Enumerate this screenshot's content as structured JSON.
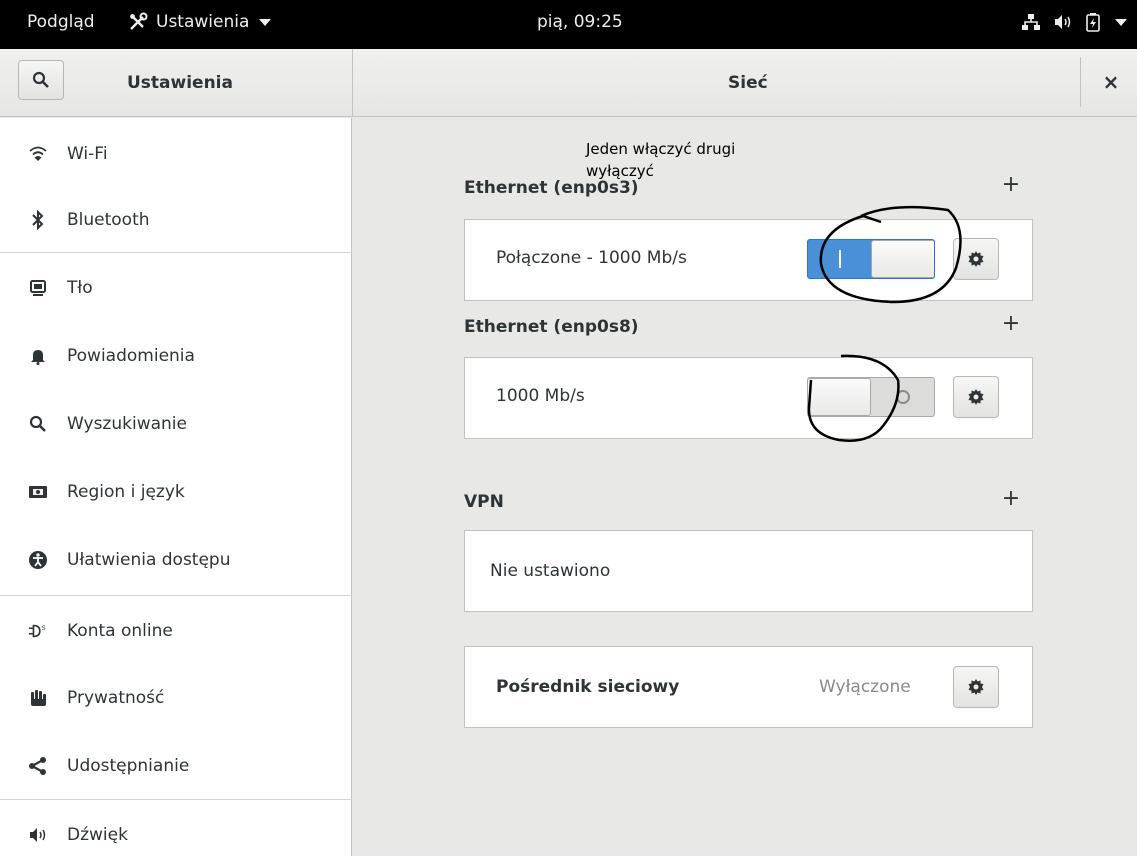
{
  "topbar": {
    "activities": "Podgląd",
    "app_menu": "Ustawienia",
    "clock": "pią, 09:25"
  },
  "header": {
    "left_title": "Ustawienia",
    "main_title": "Sieć",
    "close": "×"
  },
  "sidebar": {
    "items": [
      {
        "label": "Wi-Fi",
        "icon": "wifi-icon"
      },
      {
        "label": "Bluetooth",
        "icon": "bluetooth-icon"
      },
      {
        "label": "Tło",
        "icon": "background-icon"
      },
      {
        "label": "Powiadomienia",
        "icon": "bell-icon"
      },
      {
        "label": "Wyszukiwanie",
        "icon": "search-icon"
      },
      {
        "label": "Region i język",
        "icon": "region-icon"
      },
      {
        "label": "Ułatwienia dostępu",
        "icon": "accessibility-icon"
      },
      {
        "label": "Konta online",
        "icon": "online-accounts-icon"
      },
      {
        "label": "Prywatność",
        "icon": "privacy-hand-icon"
      },
      {
        "label": "Udostępnianie",
        "icon": "share-icon"
      },
      {
        "label": "Dźwięk",
        "icon": "speaker-icon"
      }
    ]
  },
  "network": {
    "annotation": "Jeden włączyć drugi wyłączyć",
    "ethernet1": {
      "title": "Ethernet (enp0s3)",
      "status": "Połączone - 1000 Mb/s",
      "switch_on": true
    },
    "ethernet2": {
      "title": "Ethernet (enp0s8)",
      "status": "1000 Mb/s",
      "switch_on": false
    },
    "vpn": {
      "title": "VPN",
      "status": "Nie ustawiono"
    },
    "proxy": {
      "label": "Pośrednik sieciowy",
      "value": "Wyłączone"
    },
    "add_symbol": "+"
  },
  "colors": {
    "accent": "#4a90d9",
    "topbar": "#000000"
  }
}
